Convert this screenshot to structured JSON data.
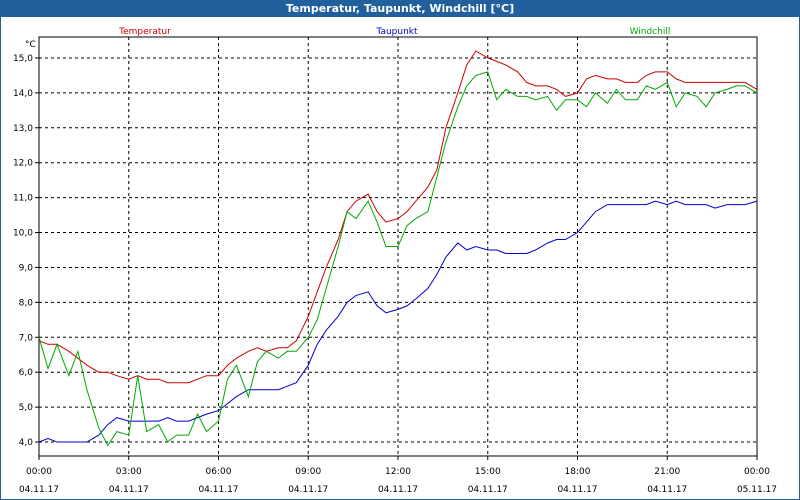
{
  "window": {
    "title": "Temperatur, Taupunkt, Windchill [°C]"
  },
  "chart_data": {
    "type": "line",
    "title": "Temperatur, Taupunkt, Windchill [°C]",
    "ylabel": "°C",
    "ylim": [
      3.6,
      15.6
    ],
    "xlim": [
      0,
      24
    ],
    "grid": true,
    "y_ticks": [
      "4,0",
      "5,0",
      "6,0",
      "7,0",
      "8,0",
      "9,0",
      "10,0",
      "11,0",
      "12,0",
      "13,0",
      "14,0",
      "15,0"
    ],
    "x_ticks": [
      {
        "time": "00:00",
        "date": "04.11.17"
      },
      {
        "time": "03:00",
        "date": "04.11.17"
      },
      {
        "time": "06:00",
        "date": "04.11.17"
      },
      {
        "time": "09:00",
        "date": "04.11.17"
      },
      {
        "time": "12:00",
        "date": "04.11.17"
      },
      {
        "time": "15:00",
        "date": "04.11.17"
      },
      {
        "time": "18:00",
        "date": "04.11.17"
      },
      {
        "time": "21:00",
        "date": "04.11.17"
      },
      {
        "time": "00:00",
        "date": "05.11.17"
      }
    ],
    "series": [
      {
        "name": "Temperatur",
        "color": "#cc0000",
        "x": [
          0,
          0.3,
          0.6,
          1.0,
          1.3,
          1.6,
          2.0,
          2.3,
          2.6,
          3.0,
          3.3,
          3.6,
          4.0,
          4.3,
          4.6,
          5.0,
          5.3,
          5.6,
          6.0,
          6.3,
          6.6,
          7.0,
          7.3,
          7.6,
          8.0,
          8.3,
          8.6,
          9.0,
          9.3,
          9.6,
          10.0,
          10.3,
          10.6,
          11.0,
          11.3,
          11.6,
          12.0,
          12.3,
          12.6,
          13.0,
          13.3,
          13.6,
          14.0,
          14.3,
          14.6,
          15.0,
          15.3,
          15.6,
          16.0,
          16.3,
          16.6,
          17.0,
          17.3,
          17.6,
          18.0,
          18.3,
          18.6,
          19.0,
          19.3,
          19.6,
          20.0,
          20.3,
          20.6,
          21.0,
          21.3,
          21.6,
          22.0,
          22.3,
          22.6,
          23.0,
          23.3,
          23.6,
          24.0
        ],
        "values": [
          6.9,
          6.8,
          6.8,
          6.6,
          6.4,
          6.2,
          6.0,
          6.0,
          5.9,
          5.8,
          5.9,
          5.8,
          5.8,
          5.7,
          5.7,
          5.7,
          5.8,
          5.9,
          5.9,
          6.2,
          6.4,
          6.6,
          6.7,
          6.6,
          6.7,
          6.7,
          6.9,
          7.6,
          8.3,
          9.0,
          9.8,
          10.6,
          10.9,
          11.1,
          10.6,
          10.3,
          10.4,
          10.6,
          10.9,
          11.3,
          11.8,
          13.0,
          14.0,
          14.8,
          15.2,
          15.0,
          14.9,
          14.8,
          14.6,
          14.3,
          14.2,
          14.2,
          14.1,
          13.9,
          14.0,
          14.4,
          14.5,
          14.4,
          14.4,
          14.3,
          14.3,
          14.5,
          14.6,
          14.6,
          14.4,
          14.3,
          14.3,
          14.3,
          14.3,
          14.3,
          14.3,
          14.3,
          14.1
        ]
      },
      {
        "name": "Taupunkt",
        "color": "#0000cc",
        "x": [
          0,
          0.3,
          0.6,
          1.0,
          1.3,
          1.6,
          2.0,
          2.3,
          2.6,
          3.0,
          3.3,
          3.6,
          4.0,
          4.3,
          4.6,
          5.0,
          5.3,
          5.6,
          6.0,
          6.3,
          6.6,
          7.0,
          7.3,
          7.6,
          8.0,
          8.3,
          8.6,
          9.0,
          9.3,
          9.6,
          10.0,
          10.3,
          10.6,
          11.0,
          11.3,
          11.6,
          12.0,
          12.3,
          12.6,
          13.0,
          13.3,
          13.6,
          14.0,
          14.3,
          14.6,
          15.0,
          15.3,
          15.6,
          16.0,
          16.3,
          16.6,
          17.0,
          17.3,
          17.6,
          18.0,
          18.3,
          18.6,
          19.0,
          19.3,
          19.6,
          20.0,
          20.3,
          20.6,
          21.0,
          21.3,
          21.6,
          22.0,
          22.3,
          22.6,
          23.0,
          23.3,
          23.6,
          24.0
        ],
        "values": [
          4.0,
          4.1,
          4.0,
          4.0,
          4.0,
          4.0,
          4.2,
          4.5,
          4.7,
          4.6,
          4.6,
          4.6,
          4.6,
          4.7,
          4.6,
          4.6,
          4.7,
          4.8,
          4.9,
          5.1,
          5.3,
          5.5,
          5.5,
          5.5,
          5.5,
          5.6,
          5.7,
          6.2,
          6.8,
          7.2,
          7.6,
          8.0,
          8.2,
          8.3,
          7.9,
          7.7,
          7.8,
          7.9,
          8.1,
          8.4,
          8.8,
          9.3,
          9.7,
          9.5,
          9.6,
          9.5,
          9.5,
          9.4,
          9.4,
          9.4,
          9.5,
          9.7,
          9.8,
          9.8,
          10.0,
          10.3,
          10.6,
          10.8,
          10.8,
          10.8,
          10.8,
          10.8,
          10.9,
          10.8,
          10.9,
          10.8,
          10.8,
          10.8,
          10.7,
          10.8,
          10.8,
          10.8,
          10.9
        ]
      },
      {
        "name": "Windchill",
        "color": "#00aa00",
        "x": [
          0,
          0.3,
          0.6,
          1.0,
          1.3,
          1.6,
          2.0,
          2.3,
          2.6,
          3.0,
          3.3,
          3.6,
          4.0,
          4.3,
          4.6,
          5.0,
          5.3,
          5.6,
          6.0,
          6.3,
          6.6,
          7.0,
          7.3,
          7.6,
          8.0,
          8.3,
          8.6,
          9.0,
          9.3,
          9.6,
          10.0,
          10.3,
          10.6,
          11.0,
          11.3,
          11.6,
          12.0,
          12.3,
          12.6,
          13.0,
          13.3,
          13.6,
          14.0,
          14.3,
          14.6,
          15.0,
          15.3,
          15.6,
          16.0,
          16.3,
          16.6,
          17.0,
          17.3,
          17.6,
          18.0,
          18.3,
          18.6,
          19.0,
          19.3,
          19.6,
          20.0,
          20.3,
          20.6,
          21.0,
          21.3,
          21.6,
          22.0,
          22.3,
          22.6,
          23.0,
          23.3,
          23.6,
          24.0
        ],
        "values": [
          7.0,
          6.1,
          6.8,
          5.9,
          6.6,
          5.5,
          4.4,
          3.9,
          4.3,
          4.2,
          5.9,
          4.3,
          4.5,
          4.0,
          4.2,
          4.2,
          4.8,
          4.3,
          4.6,
          5.8,
          6.2,
          5.3,
          6.3,
          6.6,
          6.4,
          6.6,
          6.6,
          7.0,
          7.5,
          8.4,
          9.6,
          10.6,
          10.4,
          10.9,
          10.3,
          9.6,
          9.6,
          10.2,
          10.4,
          10.6,
          11.6,
          12.6,
          13.6,
          14.2,
          14.5,
          14.6,
          13.8,
          14.1,
          13.9,
          13.9,
          13.8,
          13.9,
          13.5,
          13.8,
          13.8,
          13.6,
          14.0,
          13.7,
          14.1,
          13.8,
          13.8,
          14.2,
          14.1,
          14.3,
          13.6,
          14.0,
          13.9,
          13.6,
          14.0,
          14.1,
          14.2,
          14.2,
          14.0
        ]
      }
    ]
  }
}
